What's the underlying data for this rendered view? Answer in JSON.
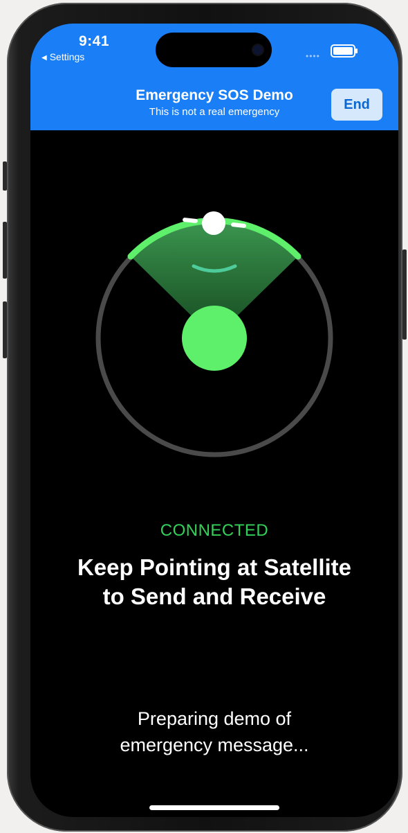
{
  "status_bar": {
    "time": "9:41",
    "back_label": "Settings",
    "back_icon": "back-arrow-icon",
    "signal_icon": "cellular-signal-icon",
    "battery_icon": "battery-icon"
  },
  "banner": {
    "title": "Emergency SOS Demo",
    "subtitle": "This is not a real emergency",
    "end_label": "End",
    "color": "#1a7ff6"
  },
  "radar": {
    "satellite_icon": "satellite-icon",
    "target_icon": "phone-direction-indicator-icon",
    "arc_color": "#5ef06b"
  },
  "main": {
    "status": "CONNECTED",
    "headline_line1": "Keep Pointing at Satellite",
    "headline_line2": "to Send and Receive",
    "message_line1": "Preparing demo of",
    "message_line2": "emergency message..."
  }
}
